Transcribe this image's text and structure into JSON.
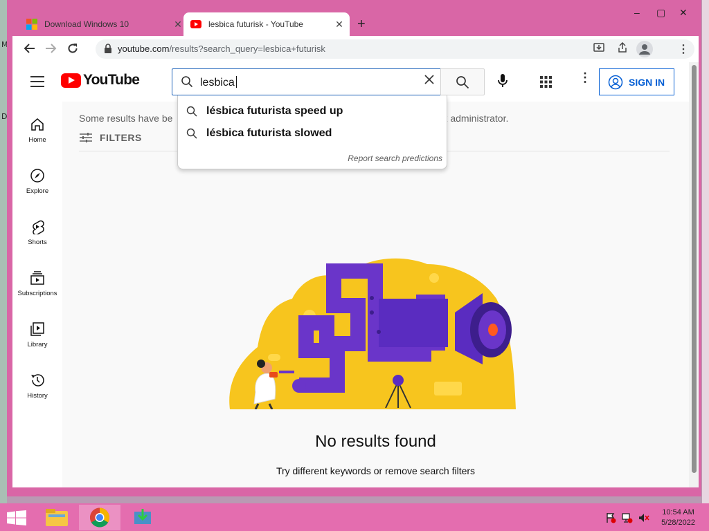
{
  "desktop": {
    "edge_chars": [
      "M",
      "D"
    ]
  },
  "browser": {
    "tabs": [
      {
        "title": "Download Windows 10",
        "close": "✕",
        "active": false
      },
      {
        "title": "lesbica futurisk - YouTube",
        "close": "✕",
        "active": true
      }
    ],
    "new_tab": "+",
    "window_controls": {
      "minimize": "–",
      "maximize": "▢",
      "close": "✕"
    },
    "url_host": "youtube.com",
    "url_path": "/results?search_query=lesbica+futurisk"
  },
  "youtube": {
    "logo_text": "YouTube",
    "search_value": "lesbica",
    "signin_label": "SIGN IN",
    "guide": [
      {
        "label": "Home",
        "icon": "home-icon"
      },
      {
        "label": "Explore",
        "icon": "compass-icon"
      },
      {
        "label": "Shorts",
        "icon": "shorts-icon"
      },
      {
        "label": "Subscriptions",
        "icon": "subscriptions-icon"
      },
      {
        "label": "Library",
        "icon": "library-icon"
      },
      {
        "label": "History",
        "icon": "history-icon"
      }
    ],
    "notice_left": "Some results have be",
    "notice_right": "ork administrator.",
    "filters_label": "FILTERS",
    "suggestions": [
      "lésbica futurista speed up",
      "lésbica futurista slowed"
    ],
    "report_predictions": "Report search predictions",
    "no_results_title": "No results found",
    "no_results_hint": "Try different keywords or remove search filters"
  },
  "taskbar": {
    "clock_time": "10:54 AM",
    "clock_date": "5/28/2022"
  },
  "colors": {
    "brand_red": "#ff0000",
    "link_blue": "#065fd4",
    "chrome_pink": "#d966a6",
    "illustration_purple": "#6a35c9",
    "illustration_yellow": "#f7c51e"
  }
}
